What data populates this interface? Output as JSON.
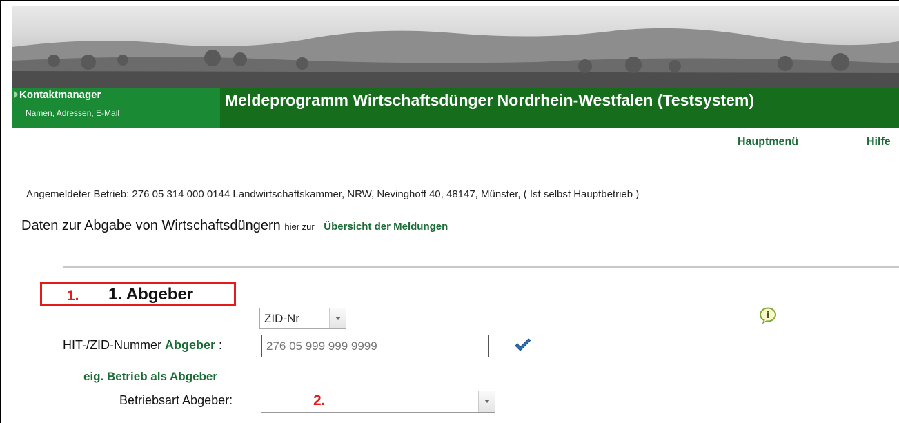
{
  "header": {
    "kontakt_title": "Kontaktmanager",
    "kontakt_sub": "Namen, Adressen, E-Mail",
    "program_title": "Meldeprogramm Wirtschaftsdünger Nordrhein-Westfalen (Testsystem)"
  },
  "nav": {
    "hauptmenu": "Hauptmenü",
    "hilfe": "Hilfe"
  },
  "info_line": "Angemeldeter Betrieb: 276 05 314 000 0144 Landwirtschaftskammer, NRW, Nevinghoff 40, 48147, Münster, ( Ist selbst Hauptbetrieb )",
  "daten": {
    "main": "Daten zur Abgabe von Wirtschaftsdüngern",
    "small": "hier zur",
    "link": "Übersicht der Meldungen"
  },
  "section1": {
    "annotation": "1.",
    "title": "1. Abgeber"
  },
  "id_type": {
    "selected": "ZID-Nr"
  },
  "hit": {
    "label": "HIT-/ZID-Nummer",
    "label_green": "Abgeber",
    "colon": ":",
    "placeholder": "276 05 999 999 9999"
  },
  "eig_link": "eig. Betrieb als Abgeber",
  "betriebsart": {
    "label": "Betriebsart Abgeber:",
    "annotation": "2."
  },
  "colors": {
    "green_dark": "#166e1d",
    "green_light": "#1a8a35",
    "link_green": "#1b6b37",
    "annotation_red": "#e31b1b"
  }
}
